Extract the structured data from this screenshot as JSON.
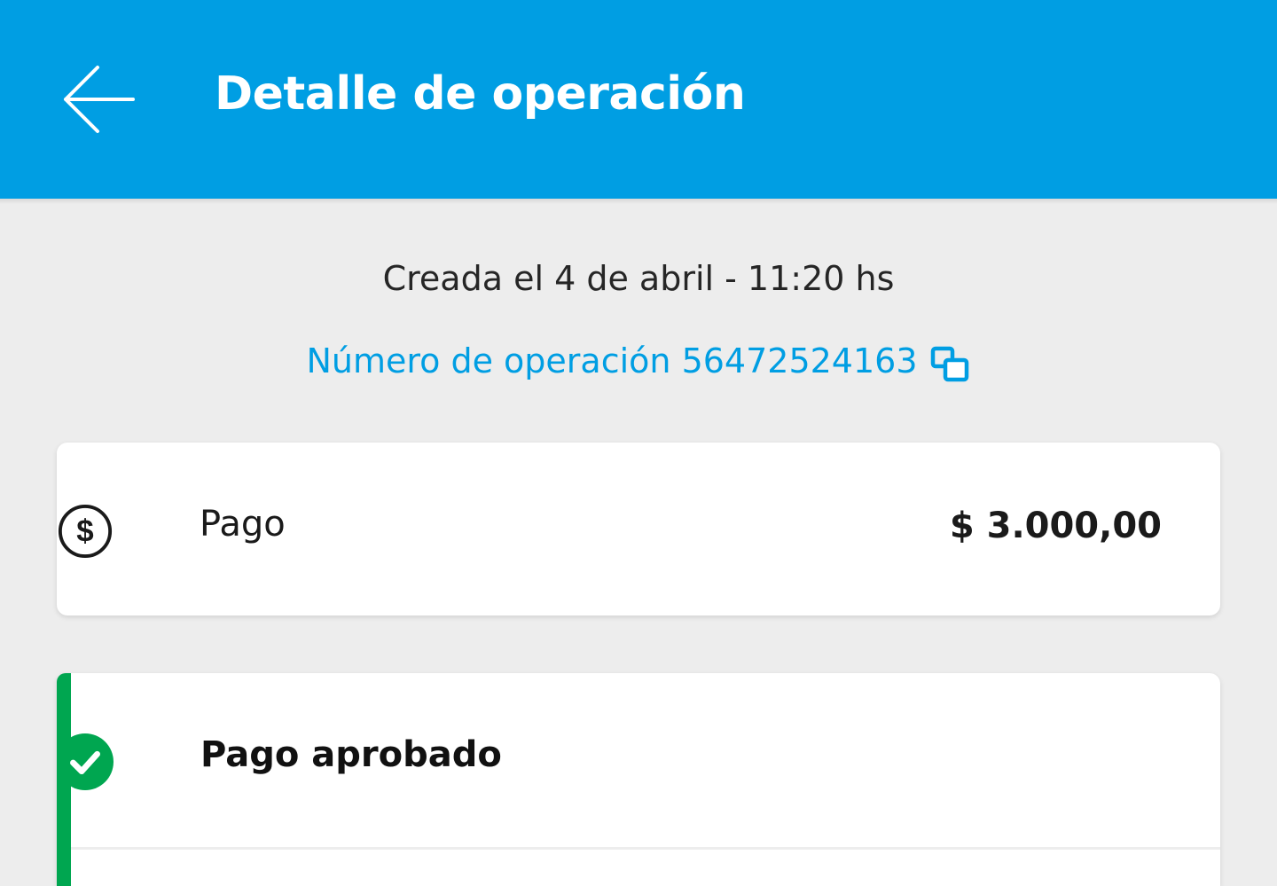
{
  "header": {
    "title": "Detalle de operación",
    "back_icon": "arrow-left-icon",
    "background_color": "#009ee3"
  },
  "operation": {
    "created": "Creada el 4 de abril - 11:20 hs",
    "number_text": "Número de operación 56472524163",
    "copy_icon": "copy-icon",
    "link_color": "#009ee3"
  },
  "payment": {
    "icon": "dollar-circle-icon",
    "label": "Pago",
    "amount": "$ 3.000,00"
  },
  "status": {
    "icon": "check-circle-icon",
    "label": "Pago aprobado",
    "accent_color": "#00a650"
  }
}
